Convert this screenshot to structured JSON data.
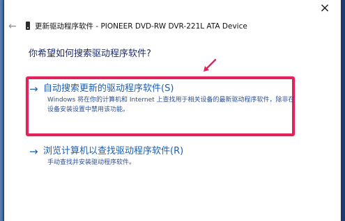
{
  "window": {
    "title": "更新驱动程序软件 - PIONEER DVD-RW   DVR-221L ATA Device",
    "close_symbol": "×",
    "back_symbol": "←"
  },
  "main": {
    "question": "你希望如何搜索驱动程序软件?"
  },
  "options": [
    {
      "arrow": "→",
      "label": "自动搜索更新的驱动程序软件(S)",
      "description": "Windows 将在你的计算机和 Internet 上查找用于相关设备的最新驱动程序软件，除非在设备安装设置中禁用该功能。"
    },
    {
      "arrow": "→",
      "label": "浏览计算机以查找驱动程序软件(R)",
      "description": "手动查找并安装驱动程序软件。"
    }
  ],
  "colors": {
    "highlight": "#e0235a",
    "link": "#1a5fb4",
    "heading": "#1b2c6e"
  },
  "icons": {
    "back": "back-arrow-icon",
    "device": "device-icon",
    "close": "close-icon",
    "annotation": "pink-arrow-icon"
  }
}
